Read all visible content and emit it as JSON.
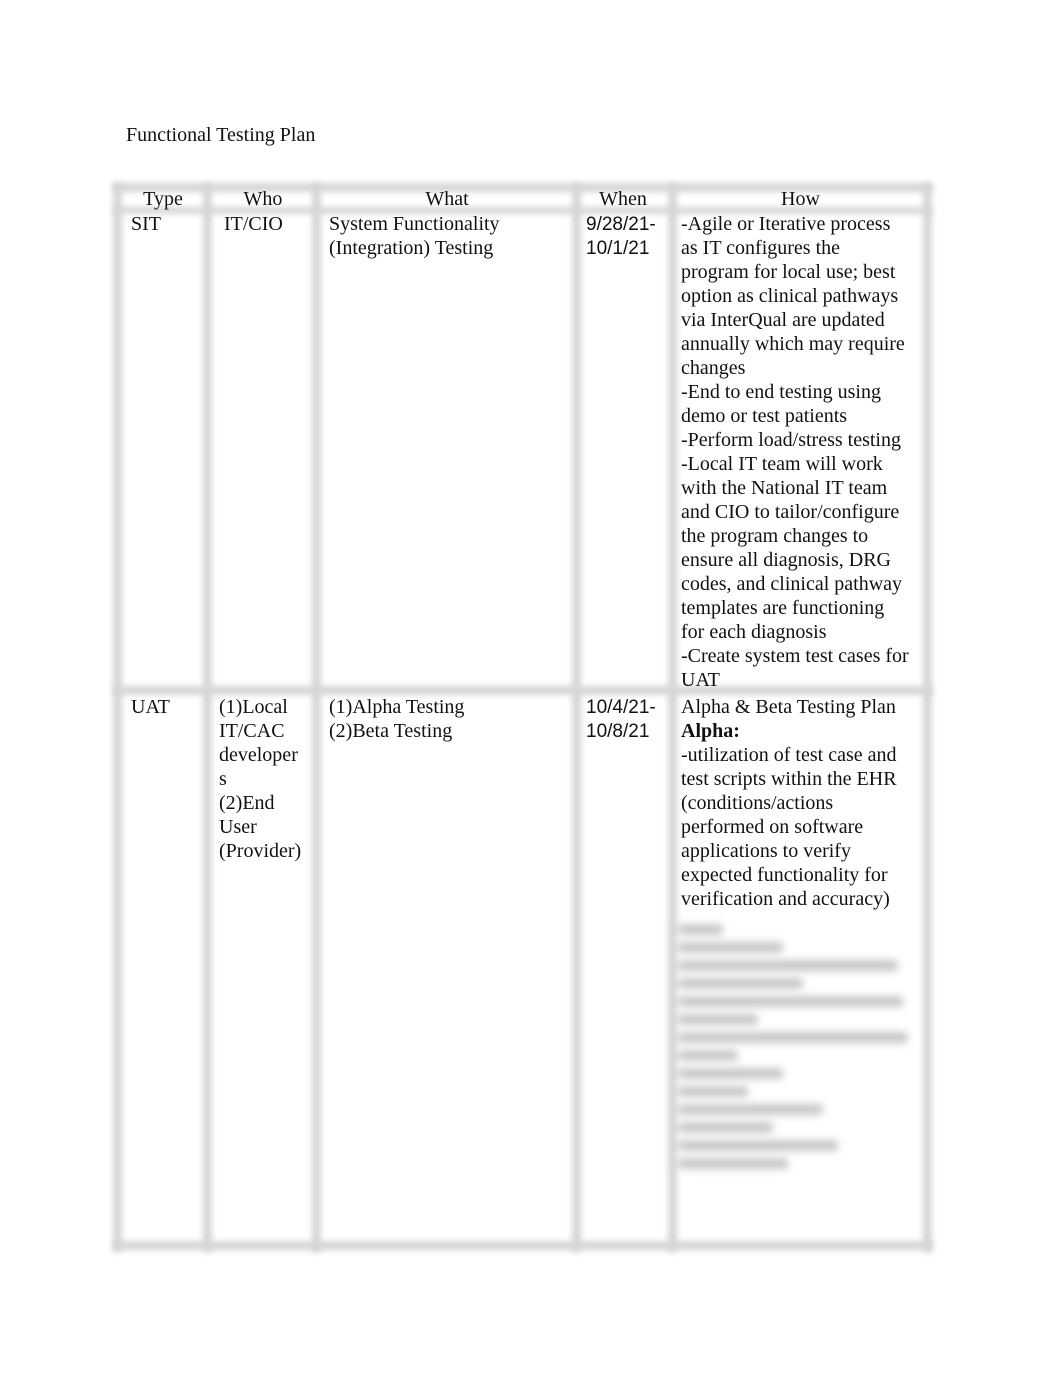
{
  "document": {
    "title": "Functional Testing Plan"
  },
  "table": {
    "headers": {
      "type": "Type",
      "who": "Who",
      "what": "What",
      "when": "When",
      "how": "How"
    },
    "rows": [
      {
        "type": "SIT",
        "who": "IT/CIO",
        "what": " System Functionality\n(Integration) Testing",
        "when": "9/28/21-\n10/1/21",
        "how": "-Agile or Iterative process\nas IT configures the\nprogram for local use; best\noption as clinical pathways\nvia InterQual are updated\nannually which may require\nchanges\n-End to end testing using\ndemo or test patients\n-Perform load/stress testing\n-Local IT team will work\nwith the National IT team\nand CIO to tailor/configure\nthe program changes to\nensure all diagnosis, DRG\ncodes, and clinical pathway\ntemplates are functioning\nfor each diagnosis\n-Create system test cases for\nUAT"
      },
      {
        "type": "UAT",
        "who": "(1)Local\nIT/CAC\ndeveloper\ns\n(2)End\nUser\n(Provider)",
        "what": "(1)Alpha Testing\n(2)Beta Testing",
        "when": "10/4/21-\n10/8/21",
        "how_heading": "Alpha & Beta Testing Plan",
        "how_subheading": "Alpha:",
        "how": "-utilization of test case and\ntest scripts within the EHR\n(conditions/actions\nperformed on software\napplications to verify\nexpected functionality for\nverification and accuracy)",
        "how_obscured_lines": 13
      }
    ]
  }
}
